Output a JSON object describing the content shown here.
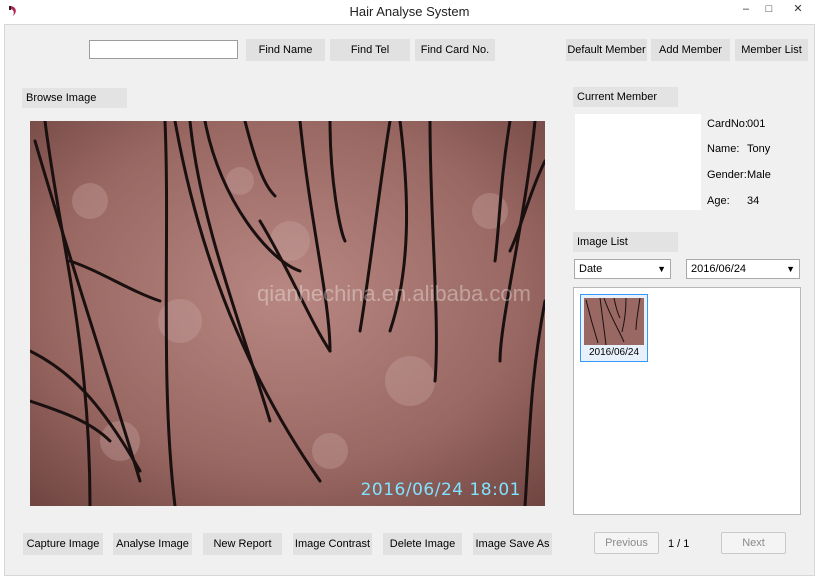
{
  "window": {
    "title": "Hair Analyse System",
    "controls": {
      "minimize": "–",
      "maximize": "□",
      "close": "✕"
    }
  },
  "search": {
    "value": "",
    "find_name": "Find Name",
    "find_tel": "Find Tel",
    "find_card": "Find Card No."
  },
  "member_actions": {
    "default_member": "Default Member",
    "add_member": "Add Member",
    "member_list": "Member List"
  },
  "browse": {
    "label": "Browse Image",
    "timestamp": "2016/06/24 18:01",
    "watermark": "qianhechina.en.alibaba.com"
  },
  "current_member": {
    "label": "Current Member",
    "fields": [
      {
        "key": "CardNo:",
        "value": "001"
      },
      {
        "key": "Name:",
        "value": "Tony"
      },
      {
        "key": "Gender:",
        "value": "Male"
      },
      {
        "key": "Age:",
        "value": "34"
      }
    ]
  },
  "image_list": {
    "label": "Image List",
    "sort_by": "Date",
    "date": "2016/06/24",
    "items": [
      {
        "label": "2016/06/24"
      }
    ]
  },
  "bottom_buttons": {
    "capture": "Capture Image",
    "analyse": "Analyse Image",
    "new_report": "New Report",
    "contrast": "Image Contrast",
    "delete": "Delete Image",
    "save_as": "Image Save As"
  },
  "pager": {
    "previous": "Previous",
    "indicator": "1 / 1",
    "next": "Next"
  },
  "colors": {
    "accent": "#3399ff",
    "timestamp": "#7fe3ff",
    "button_bg": "#e1e1e1",
    "panel_bg": "#f0f0f0"
  }
}
